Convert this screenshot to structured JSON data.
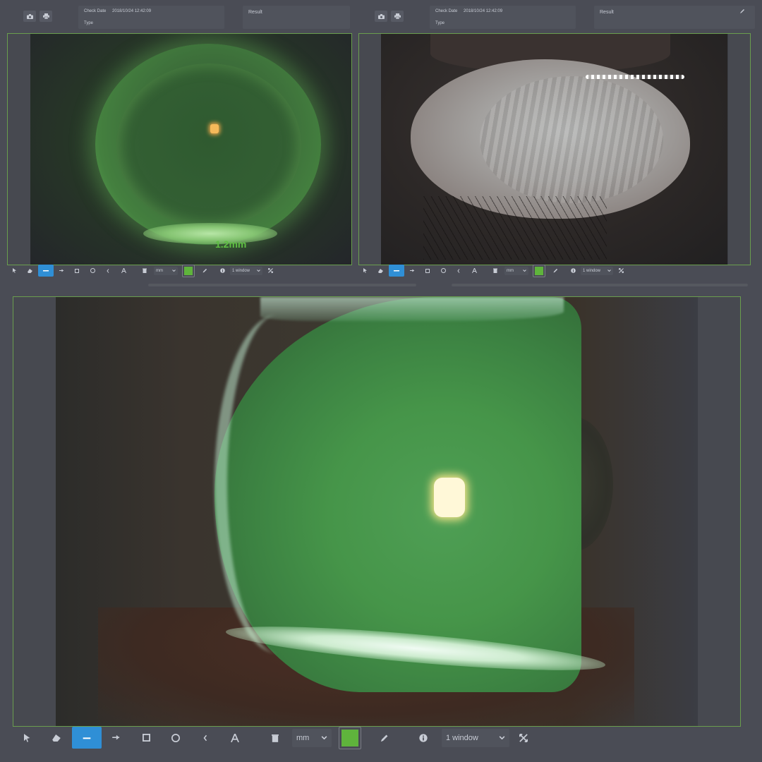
{
  "colors": {
    "accent_active": "#2f8fd6",
    "pen_color": "#5fb43c",
    "panel_border": "#6a9e4e",
    "measure_text": "#5fbf43"
  },
  "panels": [
    {
      "id": "left",
      "header": {
        "check_date_label": "Check Date",
        "check_date_value": "2018/10/24 12:42:09",
        "type_label": "Type",
        "result_label": "Result"
      },
      "measurement": "1.2mm",
      "toolbar": {
        "unit": "mm",
        "window": "1 window"
      }
    },
    {
      "id": "right",
      "header": {
        "check_date_label": "Check Date",
        "check_date_value": "2018/10/24 12:42:09",
        "type_label": "Type",
        "result_label": "Result"
      },
      "toolbar": {
        "unit": "mm",
        "window": "1 window"
      }
    }
  ],
  "main": {
    "toolbar": {
      "unit": "mm",
      "window": "1 window"
    }
  },
  "icons": [
    "camera-icon",
    "print-icon",
    "pointer-icon",
    "eraser-icon",
    "line-icon",
    "arrow-icon",
    "rectangle-icon",
    "circle-icon",
    "angle-icon",
    "text-icon",
    "trash-icon",
    "pen-color-swatch",
    "pencil-icon",
    "info-icon",
    "fullscreen-icon",
    "edit-icon"
  ]
}
